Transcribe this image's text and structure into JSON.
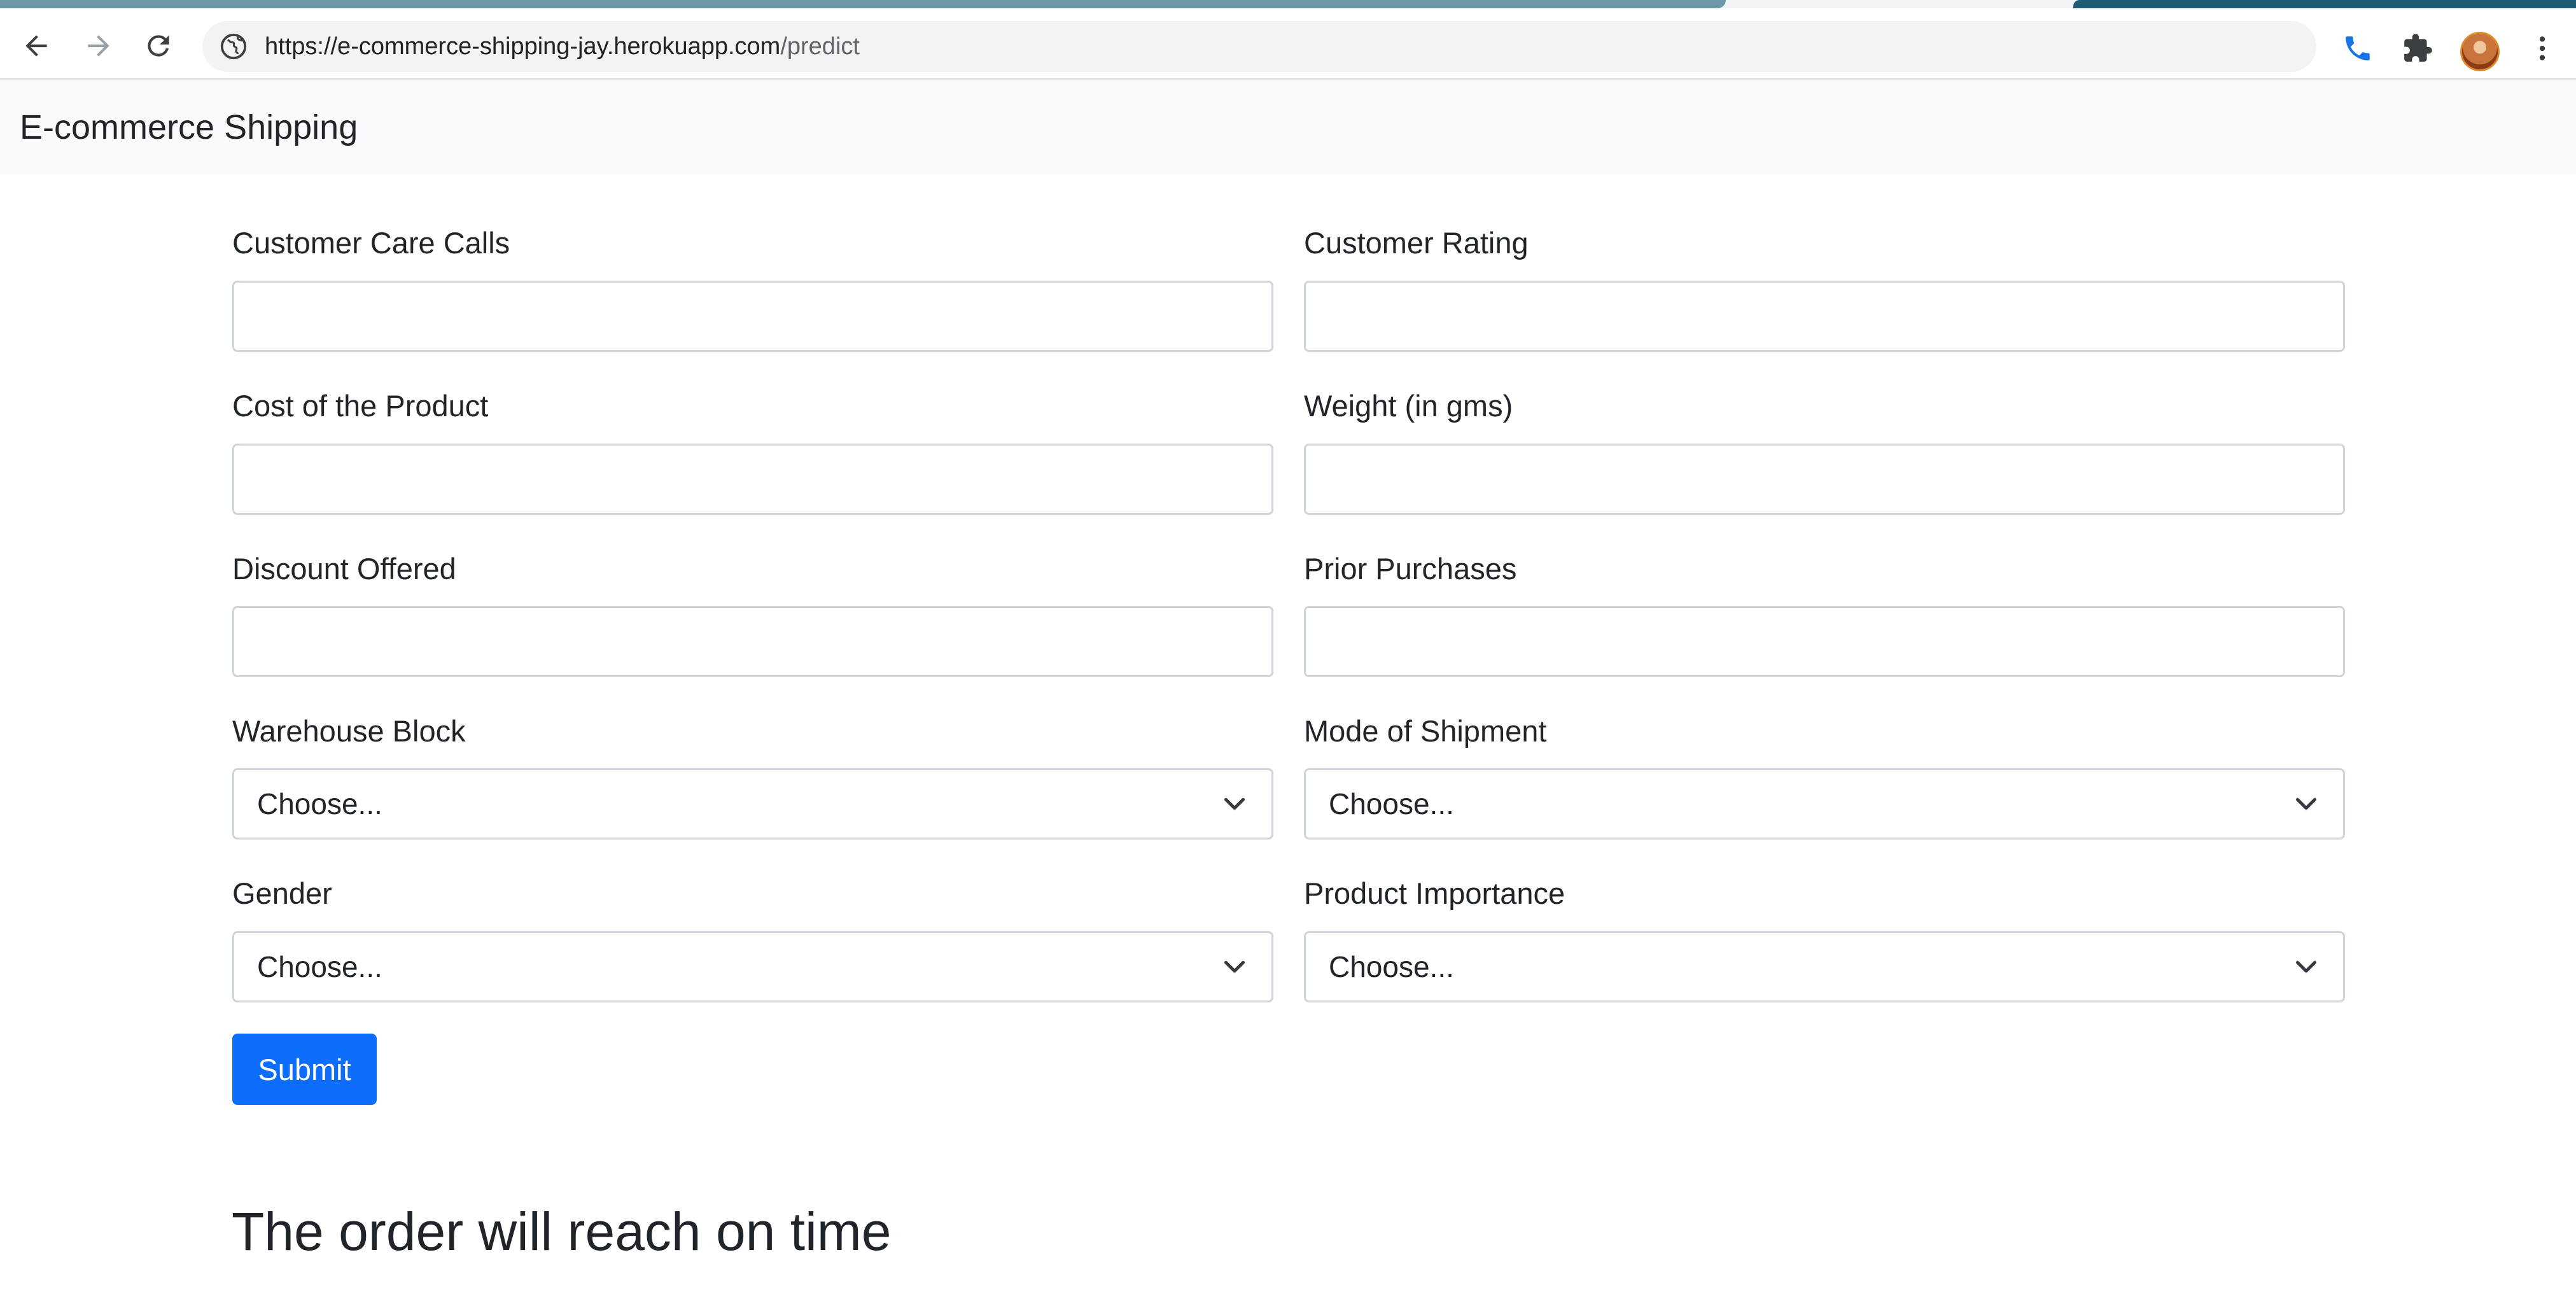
{
  "browser": {
    "url_host": "https://e-commerce-shipping-jay.herokuapp.com",
    "url_path": "/predict"
  },
  "navbar": {
    "brand": "E-commerce Shipping"
  },
  "form": {
    "fields": [
      {
        "label": "Customer Care Calls",
        "type": "input",
        "value": ""
      },
      {
        "label": "Customer Rating",
        "type": "input",
        "value": ""
      },
      {
        "label": "Cost of the Product",
        "type": "input",
        "value": ""
      },
      {
        "label": "Weight (in gms)",
        "type": "input",
        "value": ""
      },
      {
        "label": "Discount Offered",
        "type": "input",
        "value": ""
      },
      {
        "label": "Prior Purchases",
        "type": "input",
        "value": ""
      },
      {
        "label": "Warehouse Block",
        "type": "select",
        "selected": "Choose..."
      },
      {
        "label": "Mode of Shipment",
        "type": "select",
        "selected": "Choose..."
      },
      {
        "label": "Gender",
        "type": "select",
        "selected": "Choose..."
      },
      {
        "label": "Product Importance",
        "type": "select",
        "selected": "Choose..."
      }
    ],
    "submit_label": "Submit"
  },
  "result": {
    "message": "The order will reach on time"
  },
  "colors": {
    "primary_button": "#0d6efd",
    "navbar_bg": "#f8f9fa",
    "input_border": "#ced4da"
  },
  "icons": {
    "back": "back-arrow-icon",
    "forward": "forward-arrow-icon",
    "reload": "reload-icon",
    "site_info": "globe-icon",
    "phone": "phone-icon",
    "extensions": "puzzle-icon",
    "menu": "kebab-menu-icon"
  }
}
